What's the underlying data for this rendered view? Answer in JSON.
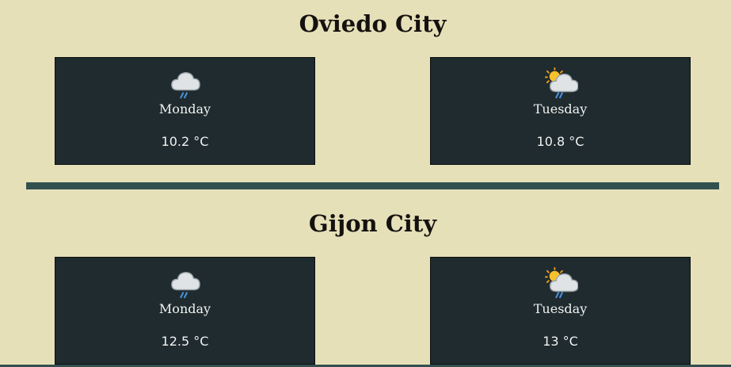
{
  "colors": {
    "background": "#e6e0b9",
    "card": "#1f2b2e",
    "divider": "#33504f",
    "text_light": "#f2f2f2",
    "title": "#14110f"
  },
  "cities": [
    {
      "title": "Oviedo City",
      "days": [
        {
          "day": "Monday",
          "temp": "10.2 °C",
          "icon": "rain-cloud-icon"
        },
        {
          "day": "Tuesday",
          "temp": "10.8 °C",
          "icon": "sun-behind-rain-cloud-icon"
        }
      ]
    },
    {
      "title": "Gijon City",
      "days": [
        {
          "day": "Monday",
          "temp": "12.5 °C",
          "icon": "rain-cloud-icon"
        },
        {
          "day": "Tuesday",
          "temp": "13 °C",
          "icon": "sun-behind-rain-cloud-icon"
        }
      ]
    }
  ]
}
